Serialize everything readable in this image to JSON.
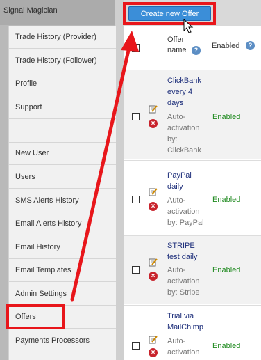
{
  "app_title": "Signal Magician",
  "nav": [
    {
      "label": "Trade History (Provider)"
    },
    {
      "label": "Trade History (Follower)"
    },
    {
      "label": "Profile"
    },
    {
      "label": "Support"
    },
    {
      "label": "New User"
    },
    {
      "label": "Users"
    },
    {
      "label": "SMS Alerts History"
    },
    {
      "label": "Email Alerts History"
    },
    {
      "label": "Email History"
    },
    {
      "label": "Email Templates"
    },
    {
      "label": "Admin Settings"
    },
    {
      "label": "Offers"
    },
    {
      "label": "Payments Processors"
    }
  ],
  "toolbar": {
    "create_label": "Create new Offer"
  },
  "table": {
    "header_offer_line1": "Offer",
    "header_offer_line2": "name",
    "header_enabled": "Enabled",
    "help_glyph": "?",
    "delete_glyph": "×",
    "rows": [
      {
        "name1": "ClickBank",
        "name2": "every 4",
        "name3": "days",
        "sub1": "Auto-",
        "sub2": "activation",
        "sub3": "by:",
        "sub4": "ClickBank",
        "status": "Enabled"
      },
      {
        "name1": "PayPal",
        "name2": "daily",
        "sub1": "Auto-",
        "sub2": "activation",
        "sub3": "by: PayPal",
        "status": "Enabled"
      },
      {
        "name1": "STRIPE",
        "name2": "test daily",
        "sub1": "Auto-",
        "sub2": "activation",
        "sub3": "by: Stripe",
        "status": "Enabled"
      },
      {
        "name1": "Trial via",
        "name2": "MailChimp",
        "sub1": "Auto-",
        "sub2": "activation",
        "status": "Enabled"
      }
    ]
  },
  "colors": {
    "accent": "#3b8ed8",
    "highlight": "#e8161b",
    "enabled": "#1f8a1f",
    "link": "#1d2e7a"
  }
}
